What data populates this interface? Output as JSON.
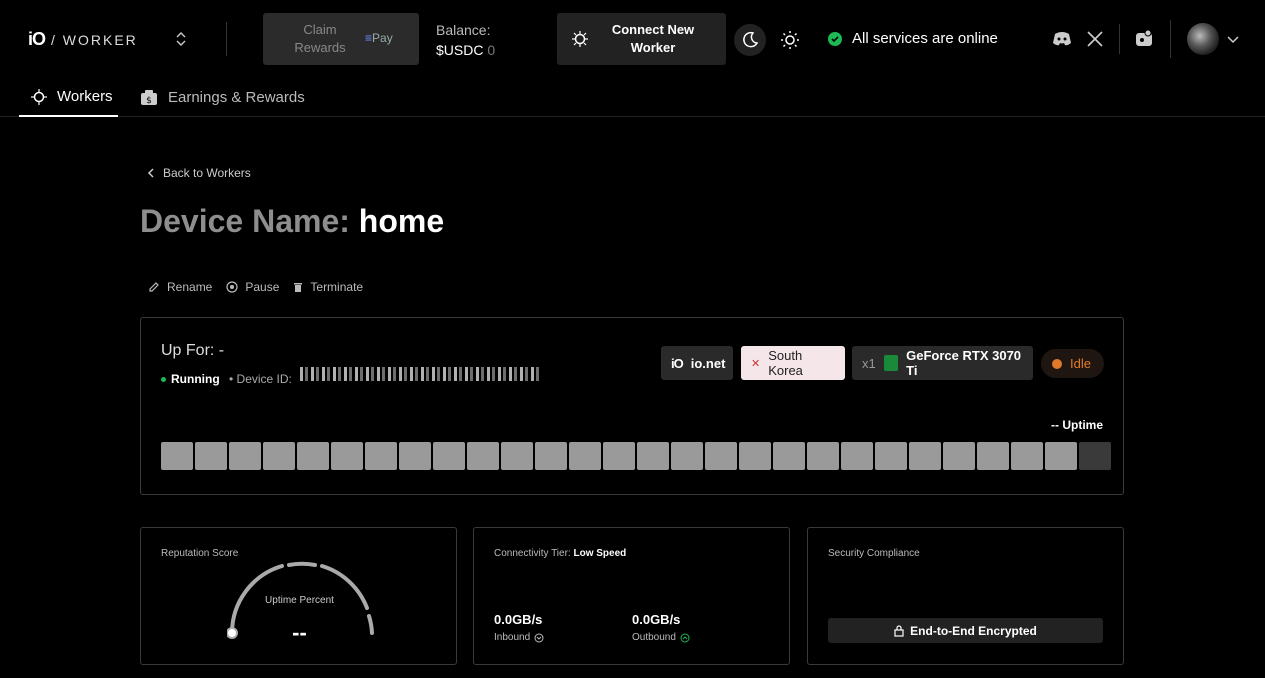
{
  "header": {
    "logo_mark": "iO",
    "logo_text": "/ WORKER",
    "claim_label": "Claim Rewards",
    "pay_label": "Pay",
    "balance_label": "Balance:",
    "balance_currency": "$USDC",
    "balance_value": "0",
    "connect_label": "Connect New Worker",
    "status_text": "All services are online",
    "icons": [
      "discord-icon",
      "x-icon",
      "discourse-icon"
    ]
  },
  "tabs": [
    {
      "label": "Workers",
      "active": true
    },
    {
      "label": "Earnings & Rewards",
      "active": false
    }
  ],
  "page": {
    "back_label": "Back to Workers",
    "title_prefix": "Device Name:",
    "device_name": "home",
    "actions": {
      "rename": "Rename",
      "pause": "Pause",
      "terminate": "Terminate"
    }
  },
  "worker": {
    "up_for": "Up For: -",
    "status": "Running",
    "device_id_label": "• Device ID:",
    "network_chip": "io.net",
    "location_chip": "South Korea",
    "gpu_count": "x1",
    "gpu_name": "GeForce RTX 3070 Ti",
    "state": "Idle",
    "uptime_label": "-- Uptime",
    "uptime_bars": [
      "g",
      "g",
      "g",
      "g",
      "g",
      "g",
      "g",
      "g",
      "g",
      "g",
      "g",
      "g",
      "g",
      "g",
      "g",
      "g",
      "g",
      "g",
      "g",
      "g",
      "g",
      "g",
      "g",
      "g",
      "g",
      "g",
      "g",
      "d"
    ]
  },
  "reputation": {
    "label": "Reputation Score",
    "gauge_label": "Uptime Percent",
    "gauge_value": "--"
  },
  "connectivity": {
    "label": "Connectivity Tier:",
    "tier": "Low Speed",
    "inbound_value": "0.0GB/s",
    "inbound_label": "Inbound",
    "outbound_value": "0.0GB/s",
    "outbound_label": "Outbound"
  },
  "security": {
    "label": "Security Compliance",
    "badge": "End-to-End Encrypted"
  },
  "colors": {
    "accent_green": "#1db954",
    "idle_orange": "#e07a2a",
    "korea_chip_bg": "#f5e6ea",
    "pay_blue": "#6a8cff"
  }
}
